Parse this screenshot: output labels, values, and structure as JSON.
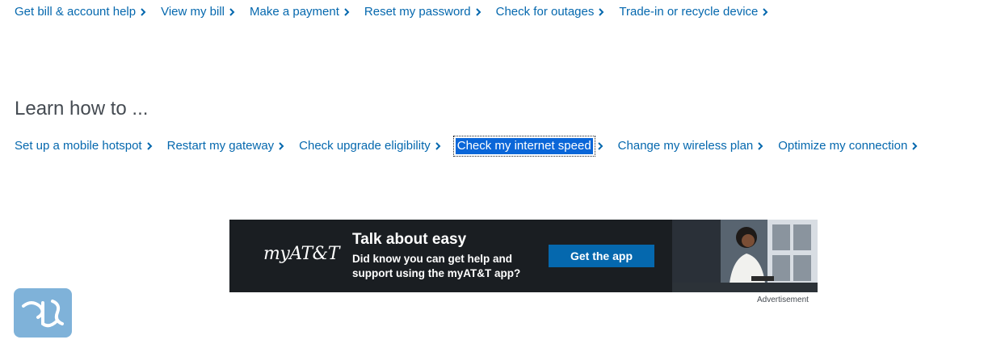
{
  "quick_links": [
    {
      "label": "Get bill & account help"
    },
    {
      "label": "View my bill"
    },
    {
      "label": "Make a payment"
    },
    {
      "label": "Reset my password"
    },
    {
      "label": "Check for outages"
    },
    {
      "label": "Trade-in or recycle device"
    }
  ],
  "learn": {
    "heading": "Learn how to ...",
    "links": [
      {
        "label": "Set up a mobile hotspot"
      },
      {
        "label": "Restart my gateway"
      },
      {
        "label": "Check upgrade eligibility"
      },
      {
        "label": "Check my internet speed",
        "selected": true
      },
      {
        "label": "Change my wireless plan"
      },
      {
        "label": "Optimize my connection"
      }
    ]
  },
  "ad": {
    "logo_text": "myAT&T",
    "headline": "Talk about easy",
    "body": "Did know you can get help and support using the myAT&T app?",
    "cta_label": "Get the app",
    "caption": "Advertisement"
  },
  "colors": {
    "link": "#0568ae",
    "heading": "#454b52",
    "selection": "#0a66d8",
    "ad_background": "#1a1e22",
    "cta_background": "#0568ae"
  },
  "icons": {
    "link_chevron": "chevron-right-icon",
    "watermark": "site-logo-watermark"
  }
}
